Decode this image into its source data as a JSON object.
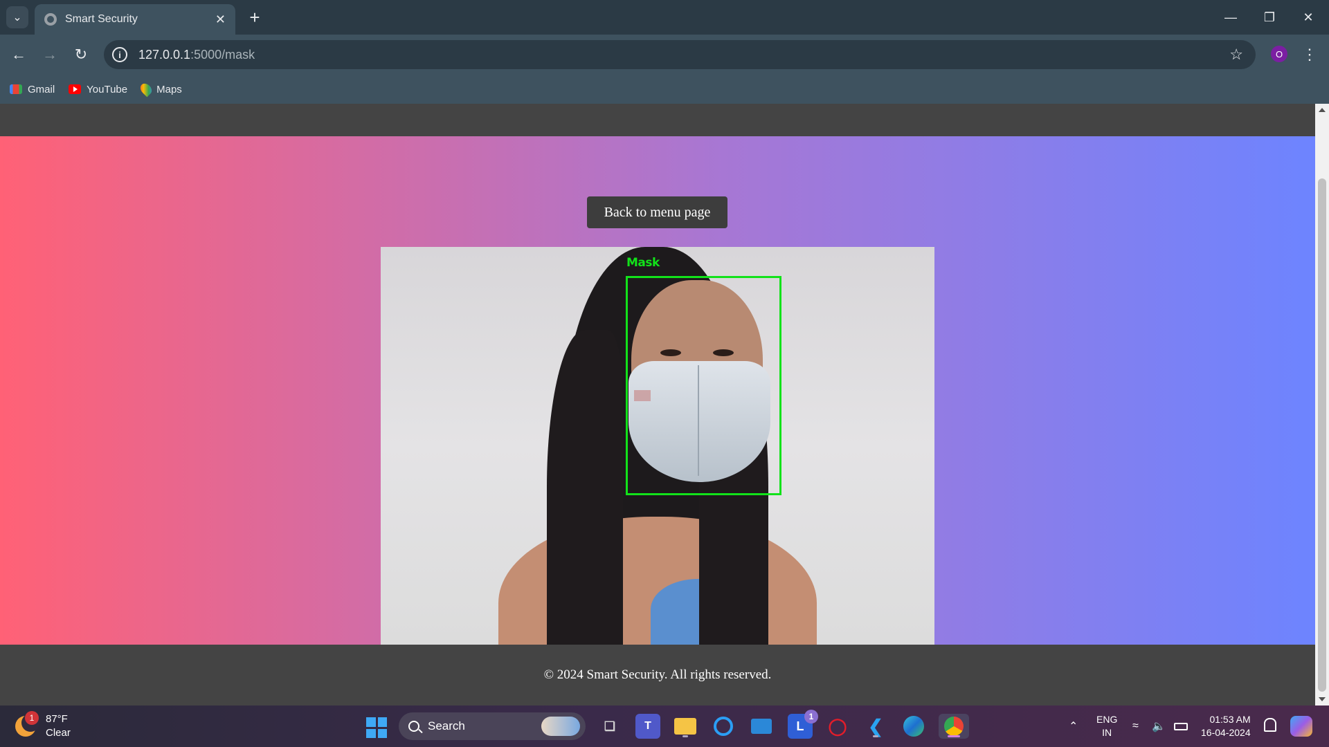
{
  "browser": {
    "tab_title": "Smart Security",
    "url_host": "127.0.0.1",
    "url_path": ":5000/mask",
    "profile_initial": "O",
    "bookmarks": [
      {
        "label": "Gmail",
        "icon": "gmail-icon"
      },
      {
        "label": "YouTube",
        "icon": "youtube-icon"
      },
      {
        "label": "Maps",
        "icon": "maps-icon"
      }
    ]
  },
  "page": {
    "back_button": "Back to menu page",
    "detection_label": "Mask",
    "footer_text": "© 2024 Smart Security. All rights reserved.",
    "colors": {
      "gradient_start": "#ff6176",
      "gradient_mid": "#a777d4",
      "gradient_end": "#6d84ff",
      "header_footer": "#444444",
      "detection_box": "#12e21a"
    }
  },
  "taskbar": {
    "weather_temp": "87°F",
    "weather_desc": "Clear",
    "weather_badge": "1",
    "search_label": "Search",
    "apps": [
      {
        "name": "task-view-icon"
      },
      {
        "name": "teams-icon"
      },
      {
        "name": "file-explorer-icon"
      },
      {
        "name": "cortana-icon"
      },
      {
        "name": "mail-icon"
      },
      {
        "name": "app-l-icon",
        "badge": "1"
      },
      {
        "name": "mcafee-icon"
      },
      {
        "name": "vscode-icon"
      },
      {
        "name": "edge-icon"
      },
      {
        "name": "chrome-icon"
      }
    ],
    "lang_line1": "ENG",
    "lang_line2": "IN",
    "time": "01:53 AM",
    "date": "16-04-2024"
  }
}
